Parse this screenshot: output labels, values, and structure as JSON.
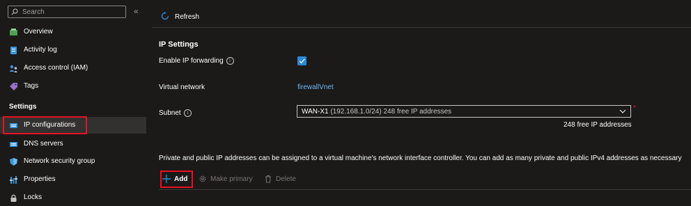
{
  "sidebar": {
    "search_placeholder": "Search",
    "collapse_glyph": "«",
    "items_top": [
      {
        "label": "Overview",
        "icon": "overview-icon"
      },
      {
        "label": "Activity log",
        "icon": "activity-log-icon"
      },
      {
        "label": "Access control (IAM)",
        "icon": "access-control-icon"
      },
      {
        "label": "Tags",
        "icon": "tag-icon"
      }
    ],
    "settings_heading": "Settings",
    "items_settings": [
      {
        "label": "IP configurations",
        "icon": "ip-configurations-icon",
        "active": true
      },
      {
        "label": "DNS servers",
        "icon": "dns-servers-icon"
      },
      {
        "label": "Network security group",
        "icon": "shield-icon"
      },
      {
        "label": "Properties",
        "icon": "properties-icon"
      },
      {
        "label": "Locks",
        "icon": "lock-icon"
      }
    ]
  },
  "toolbar": {
    "refresh_label": "Refresh"
  },
  "ip_settings": {
    "title": "IP Settings",
    "forwarding_label": "Enable IP forwarding",
    "forwarding_checked": true,
    "vnet_label": "Virtual network",
    "vnet_value": "firewallVnet",
    "subnet_label": "Subnet",
    "subnet_value_main": "WAN-X1",
    "subnet_value_detail": "(192.168.1.0/24) 248 free IP addresses",
    "subnet_free_hint": "248 free IP addresses",
    "required_marker": "*"
  },
  "description": "Private and public IP addresses can be assigned to a virtual machine's network interface controller. You can add as many private and public IPv4 addresses as necessary",
  "commands": {
    "add": "Add",
    "make_primary": "Make primary",
    "delete": "Delete"
  },
  "colors": {
    "background": "#1b1a19",
    "accent": "#2b88d8",
    "link": "#6cb8f6",
    "highlight": "#e81123"
  }
}
